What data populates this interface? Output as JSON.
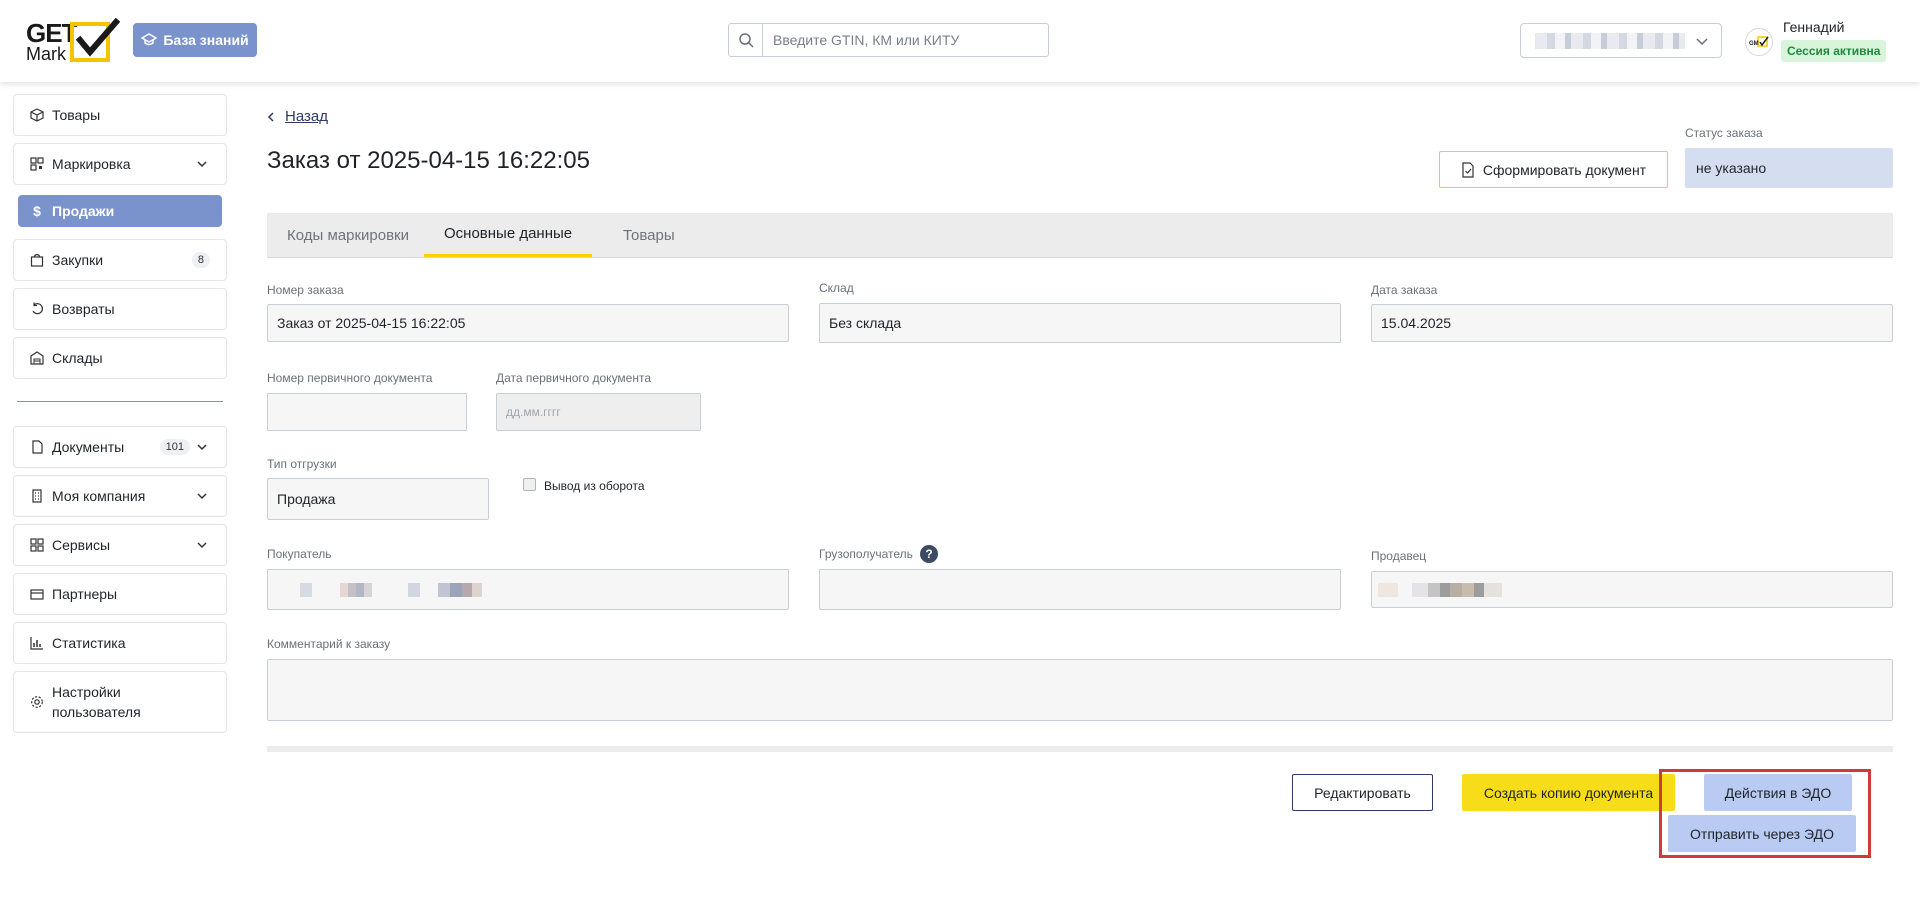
{
  "header": {
    "logo_top": "GET",
    "logo_bottom": "Mark",
    "kb_button": "База знаний",
    "search_placeholder": "Введите GTIN, КМ или КИТУ",
    "user_name": "Геннадий",
    "session_status": "Сессия активна",
    "avatar_text": "Mark"
  },
  "sidebar": {
    "items": [
      {
        "label": "Товары",
        "icon": "box-icon"
      },
      {
        "label": "Маркировка",
        "icon": "qr-icon",
        "expandable": true
      },
      {
        "label": "Продажи",
        "icon": "dollar-icon",
        "active": true
      },
      {
        "label": "Закупки",
        "icon": "bag-icon",
        "count": "8"
      },
      {
        "label": "Возвраты",
        "icon": "undo-icon"
      },
      {
        "label": "Склады",
        "icon": "warehouse-icon"
      },
      {
        "label": "Документы",
        "icon": "document-icon",
        "count": "101",
        "expandable": true
      },
      {
        "label": "Моя компания",
        "icon": "building-icon",
        "expandable": true
      },
      {
        "label": "Сервисы",
        "icon": "grid-icon",
        "expandable": true
      },
      {
        "label": "Партнеры",
        "icon": "partners-icon"
      },
      {
        "label": "Статистика",
        "icon": "chart-icon"
      },
      {
        "label": "Настройки пользователя",
        "label_line1": "Настройки",
        "label_line2": "пользователя",
        "icon": "gear-icon"
      }
    ]
  },
  "main": {
    "back_label": "Назад",
    "title": "Заказ от 2025-04-15 16:22:05",
    "generate_doc_button": "Сформировать документ",
    "status_label": "Статус заказа",
    "status_value": "не указано",
    "tabs": [
      {
        "label": "Коды маркировки"
      },
      {
        "label": "Основные данные",
        "active": true
      },
      {
        "label": "Товары"
      }
    ],
    "form": {
      "order_number_label": "Номер заказа",
      "order_number_value": "Заказ от 2025-04-15 16:22:05",
      "warehouse_label": "Склад",
      "warehouse_value": "Без склада",
      "order_date_label": "Дата заказа",
      "order_date_value": "15.04.2025",
      "primary_doc_number_label": "Номер первичного документа",
      "primary_doc_number_value": "",
      "primary_doc_date_label": "Дата первичного документа",
      "primary_doc_date_placeholder": "дд.мм.гггг",
      "shipment_type_label": "Тип отгрузки",
      "shipment_type_value": "Продажа",
      "withdraw_checkbox_label": "Вывод из оборота",
      "withdraw_checked": false,
      "buyer_label": "Покупатель",
      "consignee_label": "Грузополучатель",
      "consignee_help": "?",
      "seller_label": "Продавец",
      "comment_label": "Комментарий к заказу",
      "comment_value": ""
    },
    "actions": {
      "edit": "Редактировать",
      "copy": "Создать копию документа",
      "edo_actions": "Действия в ЭДО",
      "send_edo": "Отправить через ЭДО"
    }
  },
  "colors": {
    "accent_blue": "#7b93cc",
    "accent_yellow": "#f7dc1a",
    "edo_blue": "#b9cbf3",
    "highlight_red": "#d03a3a",
    "session_green": "#1e8a3a"
  }
}
